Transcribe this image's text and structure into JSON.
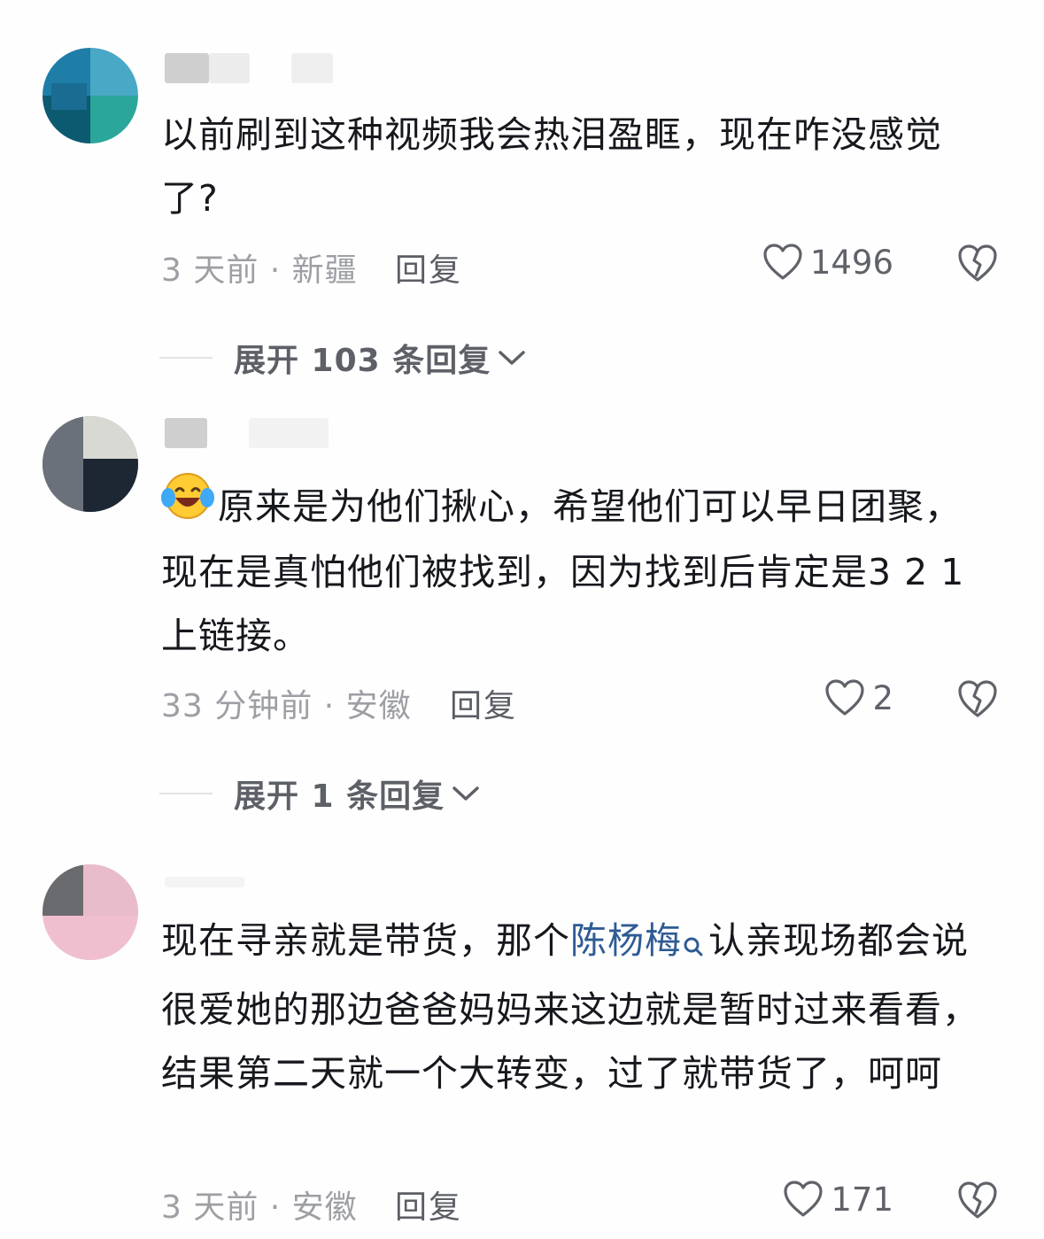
{
  "comments": [
    {
      "text": "以前刷到这种视频我会热泪盈眶，现在咋没感觉了?",
      "meta": "3 天前 · 新疆",
      "reply_label": "回复",
      "likes": "1496",
      "expand_label": "展开 103 条回复"
    },
    {
      "emoji": "laughing-crying-emoji",
      "text": "原来是为他们揪心，希望他们可以早日团聚，现在是真怕他们被找到，因为找到后肯定是3 2 1上链接。",
      "meta": "33 分钟前 · 安徽",
      "reply_label": "回复",
      "likes": "2",
      "expand_label": "展开 1 条回复"
    },
    {
      "text_before": "现在寻亲就是带货，那个",
      "link_text": "陈杨梅",
      "text_after": "认亲现场都会说很爱她的那边爸爸妈妈来这边就是暂时过来看看，结果第二天就一个大转变，过了就带货了，呵呵",
      "meta": "3 天前 · 安徽",
      "reply_label": "回复",
      "likes": "171"
    }
  ],
  "colors": {
    "text": "#16181d",
    "meta": "#9d9fa4",
    "link": "#2e5b94",
    "action": "#5d6066"
  },
  "icons": [
    "heart-icon",
    "broken-heart-icon",
    "chevron-down-icon",
    "search-icon",
    "laughing-crying-emoji"
  ]
}
